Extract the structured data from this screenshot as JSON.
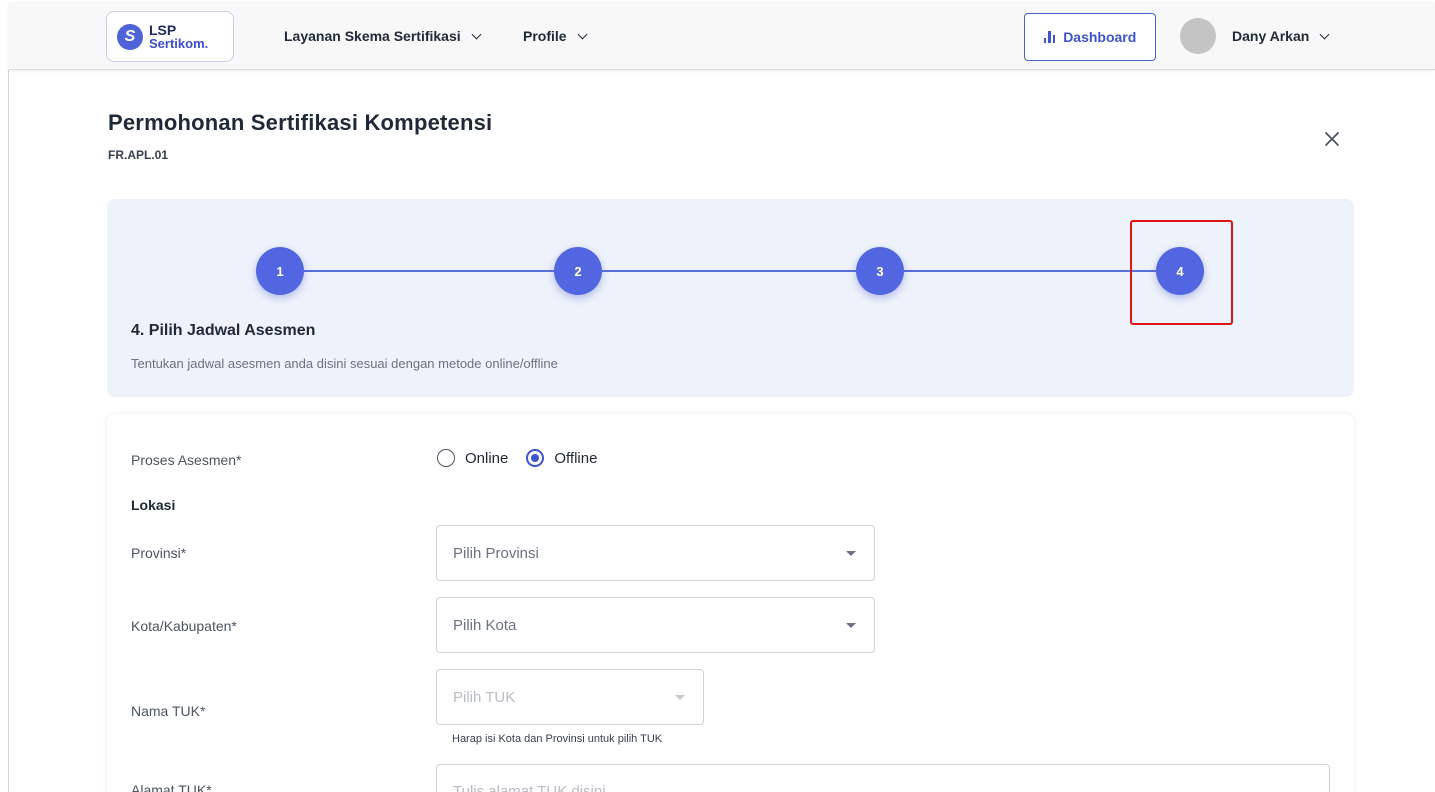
{
  "header": {
    "logo_line1": "LSP",
    "logo_line2": "Sertikom.",
    "logo_badge": "S",
    "nav": [
      {
        "label": "Layanan Skema Sertifikasi"
      },
      {
        "label": "Profile"
      }
    ],
    "dashboard_label": "Dashboard",
    "user_name": "Dany Arkan"
  },
  "page": {
    "title": "Permohonan Sertifikasi Kompetensi",
    "code": "FR.APL.01"
  },
  "stepper": {
    "steps": [
      "1",
      "2",
      "3",
      "4"
    ],
    "active_step": 4,
    "heading": "4. Pilih Jadwal Asesmen",
    "description": "Tentukan jadwal asesmen anda disini sesuai dengan metode online/offline"
  },
  "form": {
    "proses_label": "Proses Asesmen*",
    "options": [
      "Online",
      "Offline"
    ],
    "selected_option": "Offline",
    "lokasi_label": "Lokasi",
    "provinsi_label": "Provinsi*",
    "provinsi_placeholder": "Pilih Provinsi",
    "kota_label": "Kota/Kabupaten*",
    "kota_placeholder": "Pilih Kota",
    "tuk_label": "Nama TUK*",
    "tuk_placeholder": "Pilih TUK",
    "tuk_helper": "Harap isi Kota dan Provinsi untuk pilih TUK",
    "alamat_label": "Alamat TUK*",
    "alamat_placeholder": "Tulis alamat TUK disini"
  },
  "colors": {
    "accent": "#3d54cf",
    "step": "#5166e0",
    "highlight": "#e01414",
    "panel": "#eef2fb"
  }
}
